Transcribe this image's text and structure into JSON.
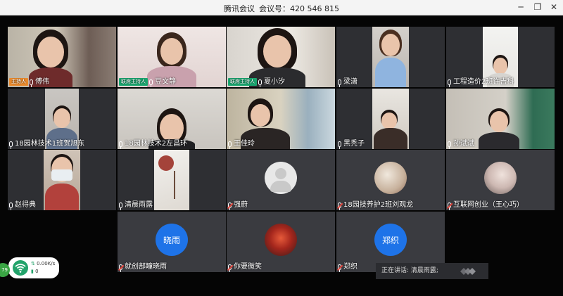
{
  "window": {
    "app_name": "腾讯会议",
    "meeting_id_label": "会议号：",
    "meeting_id": "420 546 815",
    "minimize_label": "─",
    "maximize_label": "❐",
    "close_label": "✕"
  },
  "participants": [
    {
      "name": "傅伟",
      "badge": "主持人",
      "badge_type": "host",
      "mic": "on",
      "kind": "video"
    },
    {
      "name": "豆文静",
      "badge": "联席主持人",
      "badge_type": "cohost",
      "mic": "on",
      "kind": "video"
    },
    {
      "name": "夏小汐",
      "badge": "联席主持人",
      "badge_type": "cohost",
      "mic": "on",
      "kind": "video"
    },
    {
      "name": "梁潇",
      "badge": "",
      "mic": "on",
      "kind": "video"
    },
    {
      "name": "工程造价2班许吉科",
      "badge": "",
      "mic": "on",
      "kind": "video"
    },
    {
      "name": "18园林技术1班贺旭东",
      "badge": "",
      "mic": "on",
      "kind": "video"
    },
    {
      "name": "18园林技术2左昌环",
      "badge": "",
      "mic": "on",
      "kind": "video"
    },
    {
      "name": "王佳玲",
      "badge": "",
      "mic": "on",
      "kind": "video"
    },
    {
      "name": "黑秃子",
      "badge": "",
      "mic": "on",
      "kind": "video"
    },
    {
      "name": "孙斌斌",
      "badge": "",
      "mic": "on",
      "kind": "video"
    },
    {
      "name": "赵得典",
      "badge": "",
      "mic": "on",
      "kind": "video"
    },
    {
      "name": "清晨雨露",
      "badge": "",
      "mic": "on",
      "kind": "video"
    },
    {
      "name": "强蔚",
      "badge": "",
      "mic": "muted",
      "kind": "avatar"
    },
    {
      "name": "18园技养护2班刘观龙",
      "badge": "",
      "mic": "muted",
      "kind": "avatar"
    },
    {
      "name": "互联网创业（王心巧）",
      "badge": "",
      "mic": "muted",
      "kind": "avatar"
    },
    {
      "name": "就创部瞳晓雨",
      "badge": "",
      "mic": "muted",
      "kind": "initials",
      "initials": "晓雨"
    },
    {
      "name": "你要微笑",
      "badge": "",
      "mic": "muted",
      "kind": "avatar"
    },
    {
      "name": "郑织",
      "badge": "",
      "mic": "muted",
      "kind": "initials",
      "initials": "郑织"
    }
  ],
  "speaking": {
    "label": "正在讲话:",
    "name": "清晨雨露;"
  },
  "network": {
    "upload": "0.00K/s",
    "download": "0"
  },
  "corner_badge": "79",
  "colors": {
    "host": "#e9892b",
    "cohost": "#1aa66f",
    "initials_avatar": "#1e73e8",
    "wifi": "#23a36b"
  }
}
